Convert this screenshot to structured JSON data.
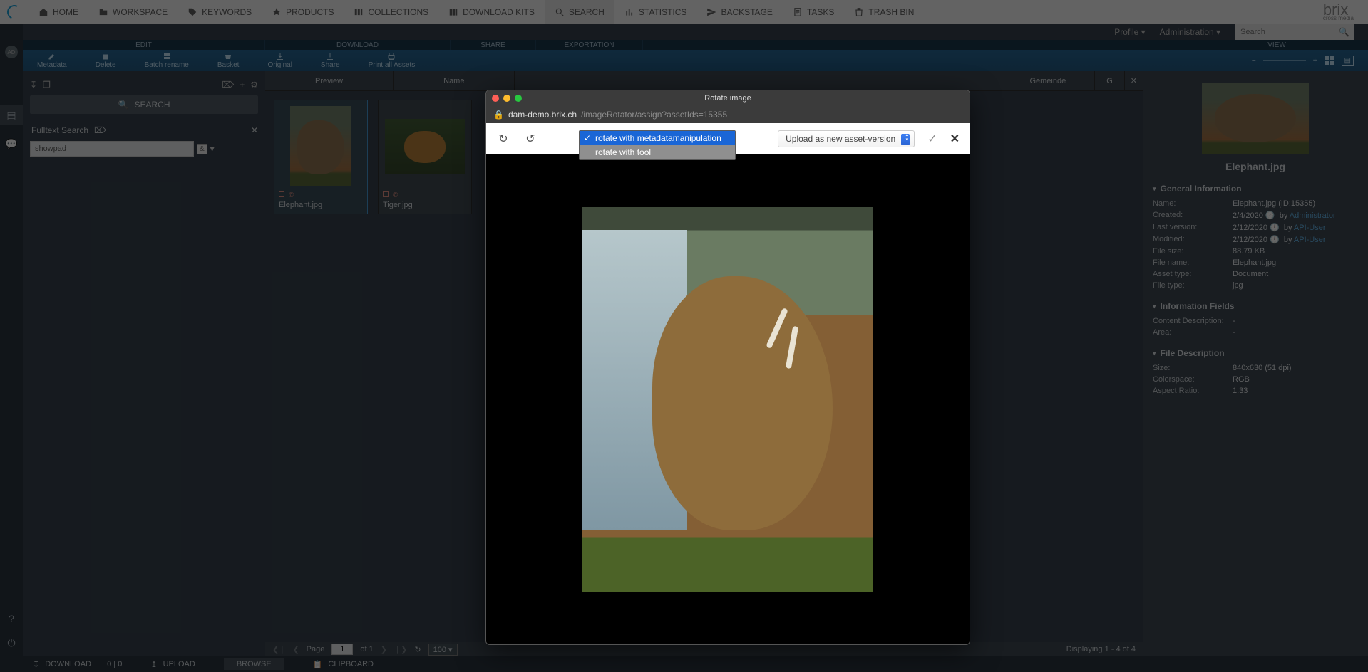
{
  "topnav": {
    "items": [
      {
        "icon": "home",
        "label": "HOME"
      },
      {
        "icon": "workspace",
        "label": "WORKSPACE"
      },
      {
        "icon": "keywords",
        "label": "KEYWORDS"
      },
      {
        "icon": "products",
        "label": "PRODUCTS"
      },
      {
        "icon": "collections",
        "label": "COLLECTIONS"
      },
      {
        "icon": "kits",
        "label": "DOWNLOAD KITS"
      },
      {
        "icon": "search",
        "label": "SEARCH"
      },
      {
        "icon": "stats",
        "label": "STATISTICS"
      },
      {
        "icon": "backstage",
        "label": "BACKSTAGE"
      },
      {
        "icon": "tasks",
        "label": "TASKS"
      },
      {
        "icon": "trash",
        "label": "TRASH BIN"
      }
    ],
    "active_index": 6,
    "logo": "brix",
    "logo_sub": "cross media"
  },
  "subnav": {
    "profile": "Profile",
    "admin": "Administration",
    "search_placeholder": "Search"
  },
  "editbar": {
    "sections": [
      "EDIT",
      "DOWNLOAD",
      "SHARE",
      "EXPORTATION"
    ],
    "view": "VIEW"
  },
  "actions": [
    {
      "id": "metadata",
      "label": "Metadata"
    },
    {
      "id": "delete",
      "label": "Delete"
    },
    {
      "id": "batchrename",
      "label": "Batch rename"
    },
    {
      "id": "basket",
      "label": "Basket"
    },
    {
      "id": "original",
      "label": "Original"
    },
    {
      "id": "share",
      "label": "Share"
    },
    {
      "id": "printall",
      "label": "Print all Assets"
    }
  ],
  "searchpanel": {
    "button": "SEARCH",
    "fulltext_label": "Fulltext Search",
    "input_value": "showpad",
    "and": "&"
  },
  "asset_tabs": {
    "preview": "Preview",
    "name": "Name",
    "gemeinde": "Gemeinde",
    "extra": "G"
  },
  "assets": [
    {
      "name": "Elephant.jpg",
      "selected": true
    },
    {
      "name": "Tiger.jpg",
      "selected": false
    }
  ],
  "paging": {
    "page_label": "Page",
    "page": "1",
    "of_label": "of 1",
    "per_page": "100",
    "summary": "Displaying 1 - 4 of 4"
  },
  "details": {
    "title": "Elephant.jpg",
    "sections": {
      "general": "General Information",
      "info_fields": "Information Fields",
      "file_desc": "File Description"
    },
    "general": [
      {
        "k": "Name:",
        "v": "Elephant.jpg (ID:15355)"
      },
      {
        "k": "Created:",
        "v": "2/4/2020",
        "by": "Administrator"
      },
      {
        "k": "Last version:",
        "v": "2/12/2020",
        "by": "API-User"
      },
      {
        "k": "Modified:",
        "v": "2/12/2020",
        "by": "API-User"
      },
      {
        "k": "File size:",
        "v": "88.79 KB"
      },
      {
        "k": "File name:",
        "v": "Elephant.jpg"
      },
      {
        "k": "Asset type:",
        "v": "Document"
      },
      {
        "k": "File type:",
        "v": "jpg"
      }
    ],
    "info": [
      {
        "k": "Content Description:",
        "v": "-"
      },
      {
        "k": "Area:",
        "v": "-"
      }
    ],
    "file": [
      {
        "k": "Size:",
        "v": "840x630 (51 dpi)"
      },
      {
        "k": "Colorspace:",
        "v": "RGB"
      },
      {
        "k": "Aspect Ratio:",
        "v": "1.33"
      }
    ],
    "by_label": "by"
  },
  "footer": {
    "download": "DOWNLOAD",
    "download_count": "0 | 0",
    "upload": "UPLOAD",
    "browse": "BROWSE",
    "clipboard": "CLIPBOARD"
  },
  "popup": {
    "title": "Rotate image",
    "url_domain": "dam-demo.brix.ch",
    "url_rest": "/imageRotator/assign?assetIds=15355",
    "options": [
      "rotate with metadatamanipulation",
      "rotate with tool"
    ],
    "selected_option_index": 0,
    "upload_label": "Upload as new asset-version"
  }
}
